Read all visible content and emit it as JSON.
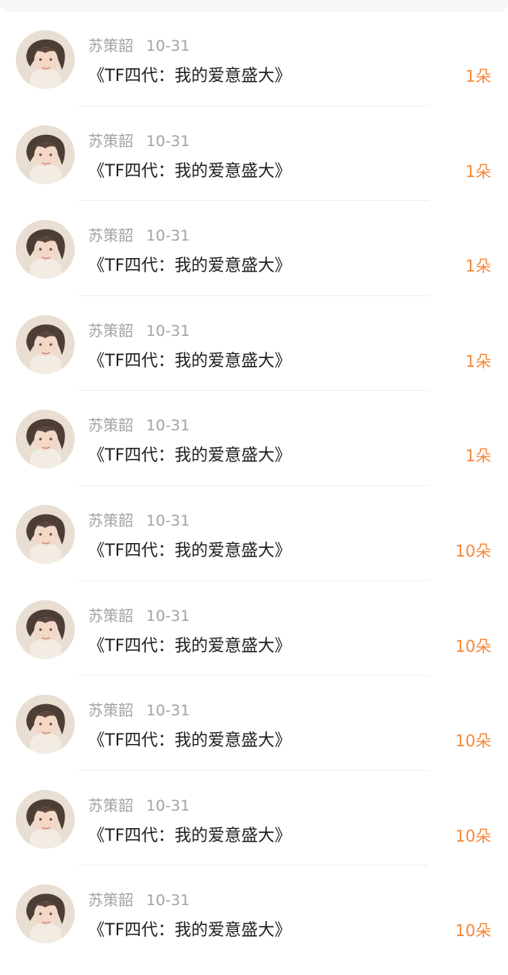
{
  "items": [
    {
      "user": "苏策韶",
      "date": "10-31",
      "title": "《TF四代：我的爱意盛大》",
      "amount": "1朵"
    },
    {
      "user": "苏策韶",
      "date": "10-31",
      "title": "《TF四代：我的爱意盛大》",
      "amount": "1朵"
    },
    {
      "user": "苏策韶",
      "date": "10-31",
      "title": "《TF四代：我的爱意盛大》",
      "amount": "1朵"
    },
    {
      "user": "苏策韶",
      "date": "10-31",
      "title": "《TF四代：我的爱意盛大》",
      "amount": "1朵"
    },
    {
      "user": "苏策韶",
      "date": "10-31",
      "title": "《TF四代：我的爱意盛大》",
      "amount": "1朵"
    },
    {
      "user": "苏策韶",
      "date": "10-31",
      "title": "《TF四代：我的爱意盛大》",
      "amount": "10朵"
    },
    {
      "user": "苏策韶",
      "date": "10-31",
      "title": "《TF四代：我的爱意盛大》",
      "amount": "10朵"
    },
    {
      "user": "苏策韶",
      "date": "10-31",
      "title": "《TF四代：我的爱意盛大》",
      "amount": "10朵"
    },
    {
      "user": "苏策韶",
      "date": "10-31",
      "title": "《TF四代：我的爱意盛大》",
      "amount": "10朵"
    },
    {
      "user": "苏策韶",
      "date": "10-31",
      "title": "《TF四代：我的爱意盛大》",
      "amount": "10朵"
    }
  ],
  "colors": {
    "amount": "#f5883a",
    "meta": "#a3a3a3",
    "title": "#1e1e1e"
  },
  "icons": {
    "avatar": "user-avatar-photo"
  }
}
